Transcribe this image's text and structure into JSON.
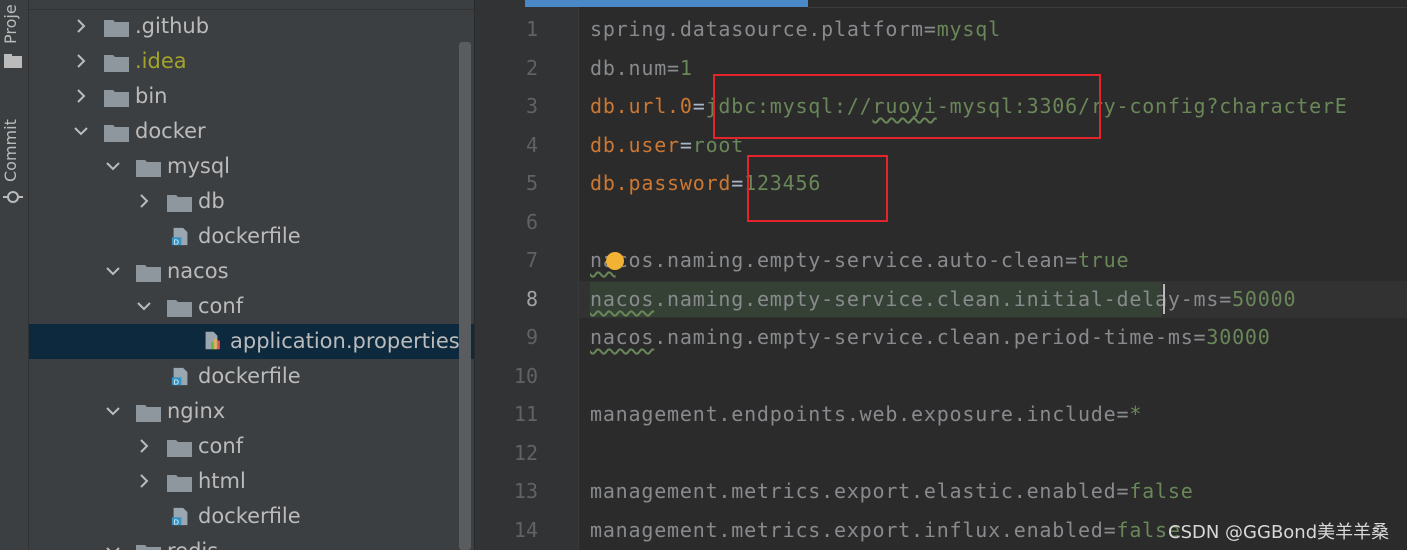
{
  "left_stripe": {
    "project_label": "Proje",
    "commit_label": "Commit"
  },
  "tree": [
    {
      "label": "github_pre",
      "text": ".github",
      "expanded": false
    },
    {
      "label": "idea",
      "text": ".idea",
      "expanded": false
    },
    {
      "label": "bin",
      "text": "bin",
      "expanded": false
    },
    {
      "label": "docker",
      "text": "docker",
      "expanded": true
    },
    {
      "label": "mysql",
      "text": "mysql",
      "expanded": true
    },
    {
      "label": "db",
      "text": "db",
      "expanded": false
    },
    {
      "label": "mysql-dockerfile",
      "text": "dockerfile"
    },
    {
      "label": "nacos",
      "text": "nacos",
      "expanded": true
    },
    {
      "label": "conf",
      "text": "conf",
      "expanded": true
    },
    {
      "label": "application-properties",
      "text": "application.properties"
    },
    {
      "label": "nacos-dockerfile",
      "text": "dockerfile"
    },
    {
      "label": "nginx",
      "text": "nginx",
      "expanded": true
    },
    {
      "label": "nginx-conf",
      "text": "conf",
      "expanded": false
    },
    {
      "label": "html",
      "text": "html",
      "expanded": false
    },
    {
      "label": "nginx-dockerfile",
      "text": "dockerfile"
    },
    {
      "label": "redis",
      "text": "redis",
      "expanded": true
    }
  ],
  "editor": {
    "line_numbers": [
      "1",
      "2",
      "3",
      "4",
      "5",
      "6",
      "7",
      "8",
      "9",
      "10",
      "11",
      "12",
      "13",
      "14"
    ],
    "current_line": "8",
    "lines": {
      "l1_key": "spring.datasource.platform",
      "l1_eq": "=",
      "l1_val": "mysql",
      "l2_key": "db.num",
      "l2_eq": "=",
      "l2_val": "1",
      "l3_key": "db.url.0",
      "l3_eq": "=",
      "l3_val_a": "jdbc:mysql://",
      "l3_val_b": "ruoyi",
      "l3_val_c": "-mysql:3306/ry-config?characterE",
      "l4_key": "db.user",
      "l4_eq": "=",
      "l4_val": "root",
      "l5_key": "db.password",
      "l5_eq": "=",
      "l5_val": "123456",
      "l7_a": "na",
      "l7_b": "cos.naming.empty-service.auto-clean",
      "l7_eq": "=",
      "l7_val": "true",
      "l8_a": "nacos",
      "l8_b": ".naming.empty-service.clean.initial-delay-ms",
      "l8_eq": "=",
      "l8_val": "50000",
      "l9_a": "nacos",
      "l9_b": ".naming.empty-service.clean.period-time-ms",
      "l9_eq": "=",
      "l9_val": "30000",
      "l11_key": "management.endpoints.web.exposure.include",
      "l11_eq": "=",
      "l11_val": "*",
      "l13_key": "management.metrics.export.elastic.enabled",
      "l13_eq": "=",
      "l13_val": "false",
      "l14_key": "management.metrics.export.influx.enabled",
      "l14_eq": "=",
      "l14_val": "false"
    }
  },
  "watermark": "CSDN @GGBond美羊羊桑",
  "colors": {
    "key": "#cc7832",
    "value": "#6a8759",
    "annotation_box": "#e3242b",
    "selection": "#0d293e"
  }
}
